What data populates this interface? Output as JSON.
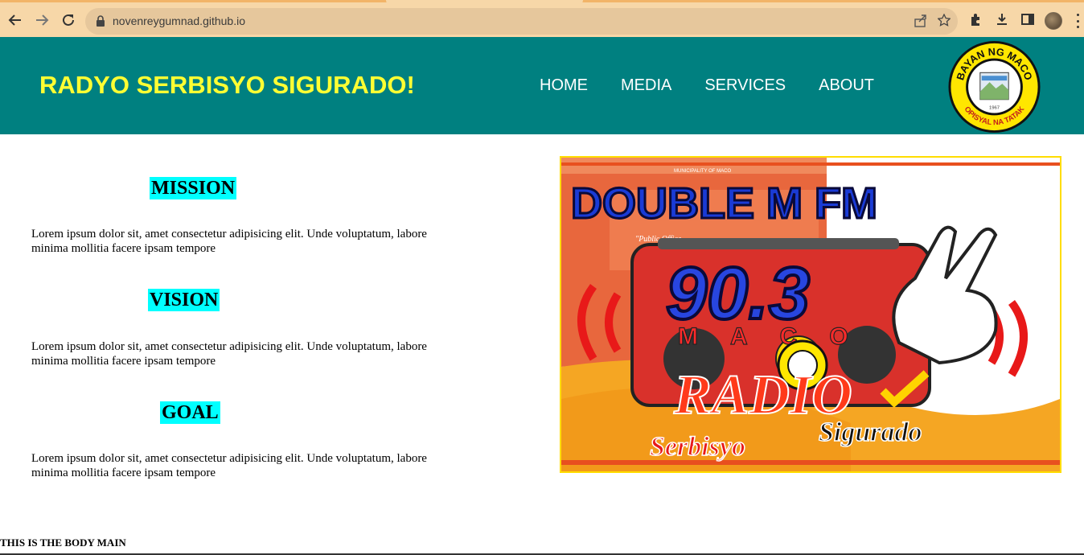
{
  "browser": {
    "url": "novenreygumnad.github.io",
    "icons": [
      "back-arrow-icon",
      "forward-arrow-icon",
      "reload-icon",
      "lock-icon",
      "share-icon",
      "star-icon",
      "extensions-icon",
      "download-icon",
      "side-panel-icon",
      "profile-avatar",
      "more-menu-icon"
    ],
    "colors": {
      "toolbar": "#f7d7a8",
      "omnibox": "#e6c79c"
    }
  },
  "header": {
    "title": "RADYO SERBISYO SIGURADO!",
    "nav": [
      "HOME",
      "MEDIA",
      "SERVICES",
      "ABOUT"
    ],
    "logo": {
      "top_text": "BAYAN NG MACO",
      "bottom_text": "OPISYAL NA TATAK",
      "year": "1967"
    },
    "colors": {
      "background": "#008080",
      "title": "#ffff33"
    }
  },
  "main": {
    "sections": [
      {
        "heading": "MISSION",
        "text": "Lorem ipsum dolor sit, amet consectetur adipisicing elit. Unde voluptatum, labore minima mollitia facere ipsam tempore"
      },
      {
        "heading": "VISION",
        "text": "Lorem ipsum dolor sit, amet consectetur adipisicing elit. Unde voluptatum, labore minima mollitia facere ipsam tempore"
      },
      {
        "heading": "GOAL",
        "text": "Lorem ipsum dolor sit, amet consectetur adipisicing elit. Unde voluptatum, labore minima mollitia facere ipsam tempore"
      }
    ],
    "heading_highlight": "#00ffff",
    "hero_image": {
      "title": "DOUBLE M FM",
      "frequency": "90.3",
      "place": "MACO",
      "word_radio": "RADIO",
      "tagline_1": "Serbisyo",
      "tagline_2": "Sigurado",
      "building_sign": "MUNICIPALITY OF MACO",
      "building_quote": "\"Public Office"
    }
  },
  "footer": {
    "text": "THIS IS THE BODY MAIN"
  }
}
